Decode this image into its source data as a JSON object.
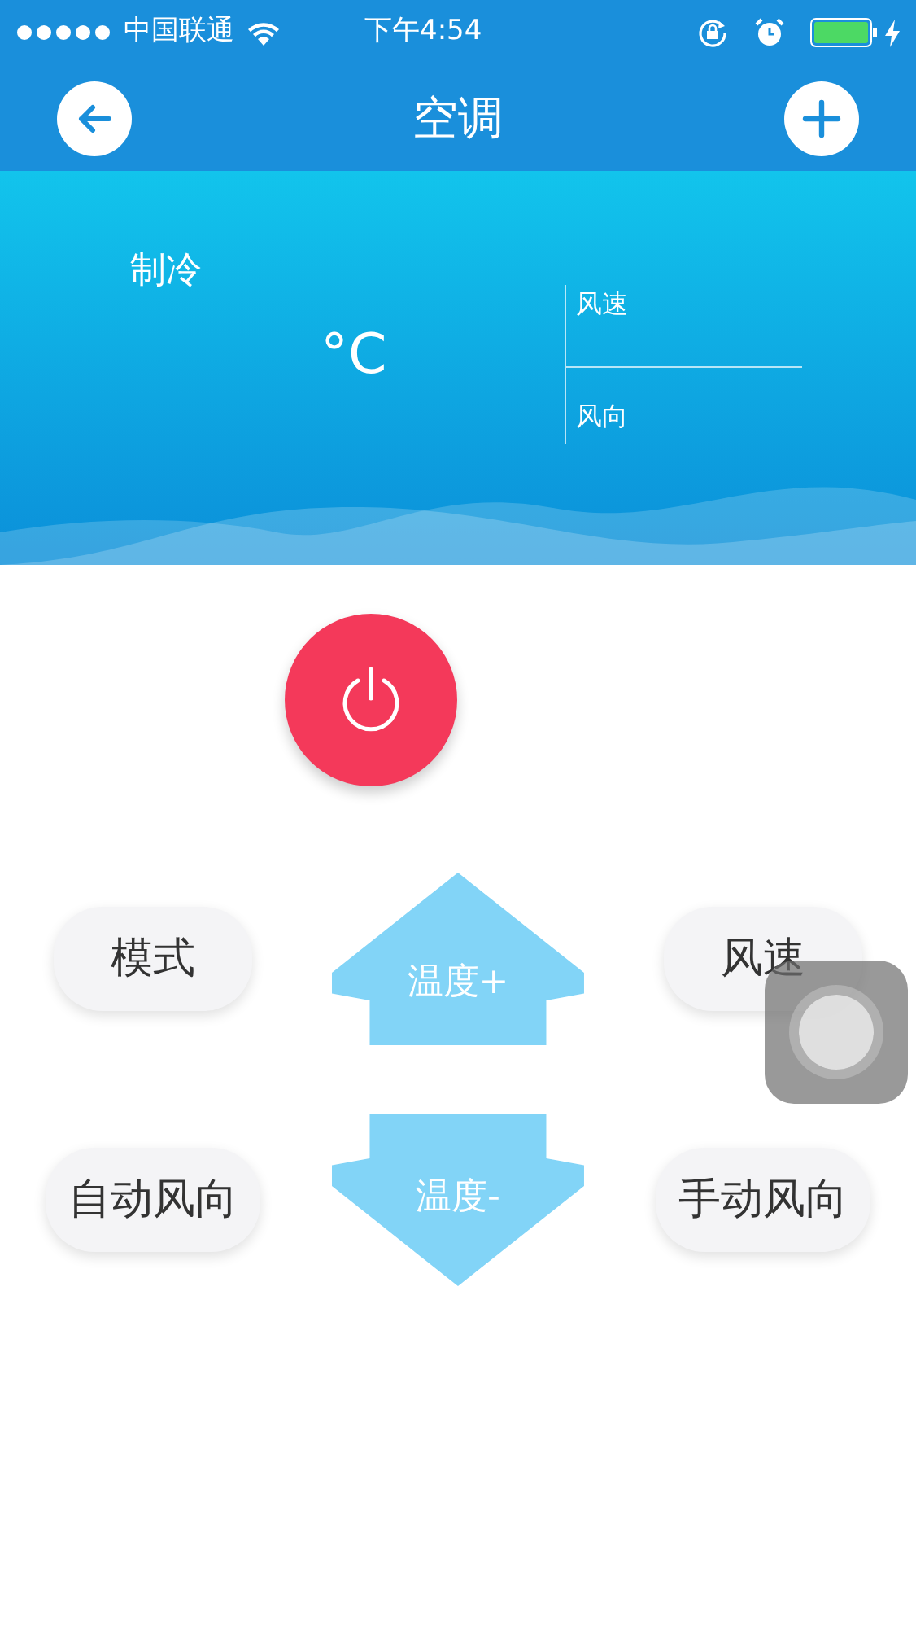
{
  "status_bar": {
    "carrier": "中国联通",
    "time": "下午4:54"
  },
  "nav": {
    "title": "空调"
  },
  "panel": {
    "mode": "制冷",
    "temperature": "°C",
    "fan_speed_label": "风速",
    "fan_direction_label": "风向"
  },
  "controls": [
    {
      "label": "模式",
      "kind": "pill"
    },
    {
      "label": "温度+",
      "kind": "up"
    },
    {
      "label": "风速",
      "kind": "pill"
    },
    {
      "label": "自动风向",
      "kind": "pill"
    },
    {
      "label": "温度-",
      "kind": "down"
    },
    {
      "label": "手动风向",
      "kind": "pill"
    }
  ]
}
